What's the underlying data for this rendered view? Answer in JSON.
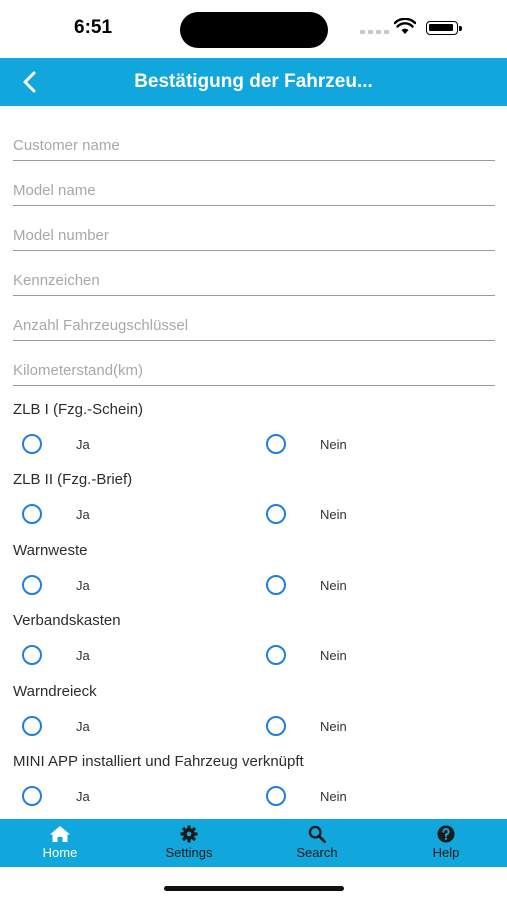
{
  "status_bar": {
    "time": "6:51"
  },
  "header": {
    "title": "Bestätigung der Fahrzeu..."
  },
  "form": {
    "fields": [
      {
        "placeholder": "Customer name",
        "value": ""
      },
      {
        "placeholder": "Model name",
        "value": ""
      },
      {
        "placeholder": "Model number",
        "value": ""
      },
      {
        "placeholder": "Kennzeichen",
        "value": ""
      },
      {
        "placeholder": "Anzahl Fahrzeugschlüssel",
        "value": ""
      },
      {
        "placeholder": "Kilometerstand(km)",
        "value": ""
      }
    ],
    "questions": [
      {
        "label": "ZLB I (Fzg.-Schein)",
        "yes": "Ja",
        "no": "Nein"
      },
      {
        "label": "ZLB II (Fzg.-Brief)",
        "yes": "Ja",
        "no": "Nein"
      },
      {
        "label": "Warnweste",
        "yes": "Ja",
        "no": "Nein"
      },
      {
        "label": "Verbandskasten",
        "yes": "Ja",
        "no": "Nein"
      },
      {
        "label": "Warndreieck",
        "yes": "Ja",
        "no": "Nein"
      },
      {
        "label": "MINI APP installiert und Fahrzeug verknüpft",
        "yes": "Ja",
        "no": "Nein"
      }
    ]
  },
  "tabs": [
    {
      "label": "Home",
      "icon": "home-icon",
      "active": true
    },
    {
      "label": "Settings",
      "icon": "gear-icon",
      "active": false
    },
    {
      "label": "Search",
      "icon": "search-icon",
      "active": false
    },
    {
      "label": "Help",
      "icon": "help-icon",
      "active": false
    }
  ],
  "colors": {
    "accent": "#11a7dc",
    "radio": "#1f7fe0"
  }
}
